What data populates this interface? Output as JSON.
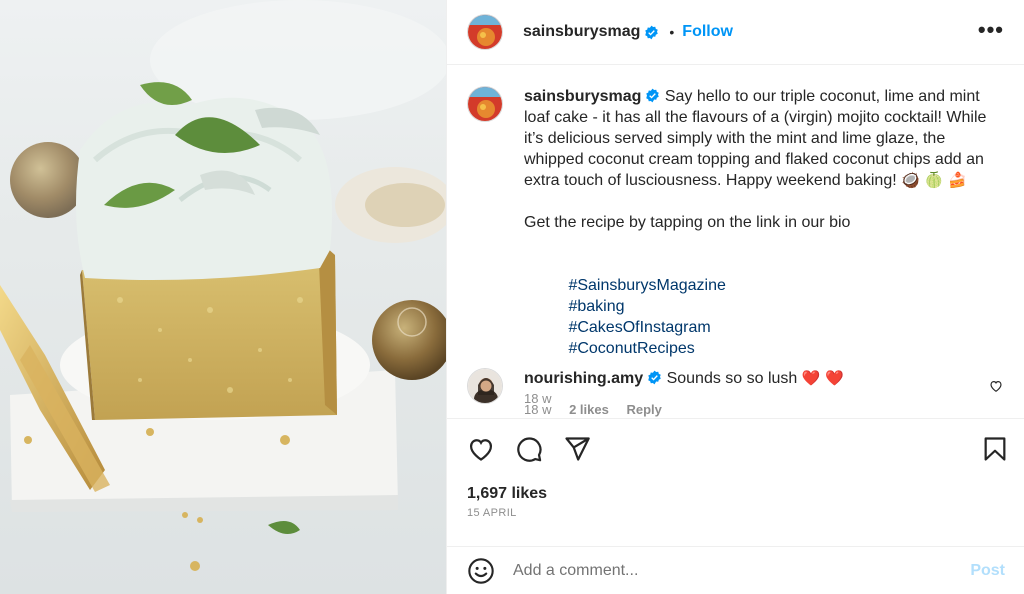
{
  "post": {
    "account": "sainsburysmag",
    "follow_label": "Follow",
    "separator": "•",
    "more_label": "•••",
    "caption": {
      "username": "sainsburysmag",
      "text_line1": "Say hello to our triple coconut, lime and mint loaf cake - it has all the flavours of a (virgin) mojito cocktail! While it’s delicious served simply with the mint and lime glaze, the whipped coconut cream topping and flaked coconut chips add an extra touch of lusciousness. Happy weekend baking!",
      "emojis": "🥥 🍈 🍰",
      "text_line2": "Get the recipe by tapping on the link in our bio",
      "hashtags": [
        "#SainsburysMagazine",
        "#baking",
        "#CakesOfInstagram",
        "#CoconutRecipes"
      ],
      "age": "18 w"
    },
    "comments": [
      {
        "username": "nourishing.amy",
        "text": "Sounds so so lush",
        "hearts": "❤️ ❤️",
        "age": "18 w",
        "likes": "2 likes",
        "reply_label": "Reply"
      }
    ],
    "likes": "1,697 likes",
    "date": "15 APRIL",
    "comment_box": {
      "placeholder": "Add a comment...",
      "post_label": "Post"
    }
  },
  "icons": {
    "verified": "verified-badge-icon",
    "like": "heart-icon",
    "comment": "comment-bubble-icon",
    "share": "paper-plane-icon",
    "save": "bookmark-icon",
    "emoji": "smiley-icon",
    "comment_like": "small-heart-icon"
  },
  "colors": {
    "link_blue": "#0095f6",
    "hashtag": "#00376b",
    "verified": "#0095f6",
    "muted": "#8e8e8e",
    "post_disabled": "#b2dffc"
  }
}
